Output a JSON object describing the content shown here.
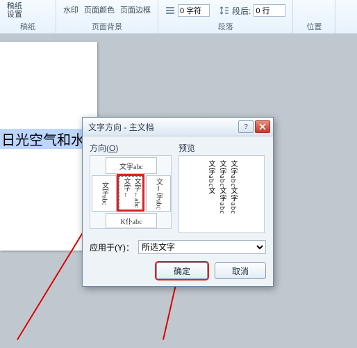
{
  "ribbon": {
    "group_draft": {
      "line1": "稿纸",
      "line2": "设置",
      "label": "稿纸"
    },
    "group_bg": {
      "btn_watermark": "水印",
      "btn_pagecolor": "页面颜色",
      "btn_border": "页面边框",
      "label": "页面背景"
    },
    "group_para": {
      "indent_left_label": "缩进",
      "indent_left_value": "0 字符",
      "spacing_after_label": "段后:",
      "spacing_after_value": "0 行",
      "label": "段落"
    },
    "group_pos": {
      "label": "位置"
    }
  },
  "document": {
    "selected_text": "日光空气和水"
  },
  "dialog": {
    "title": "文字方向 - 主文档",
    "orient_label": "方向",
    "orient_key": "O",
    "preview_label": "预览",
    "samples": {
      "horiz": "文字abc",
      "vert1": "文字abc",
      "vert2": "文字←abc文字←",
      "vert3": "文‖字abc",
      "horiz2": "K仆abc"
    },
    "preview_text": "文字abc文字abc文字abc文字abc文字abc文",
    "apply_label": "应用于",
    "apply_key": "Y",
    "apply_options": [
      "所选文字"
    ],
    "apply_selected": "所选文字",
    "ok": "确定",
    "cancel": "取消"
  }
}
